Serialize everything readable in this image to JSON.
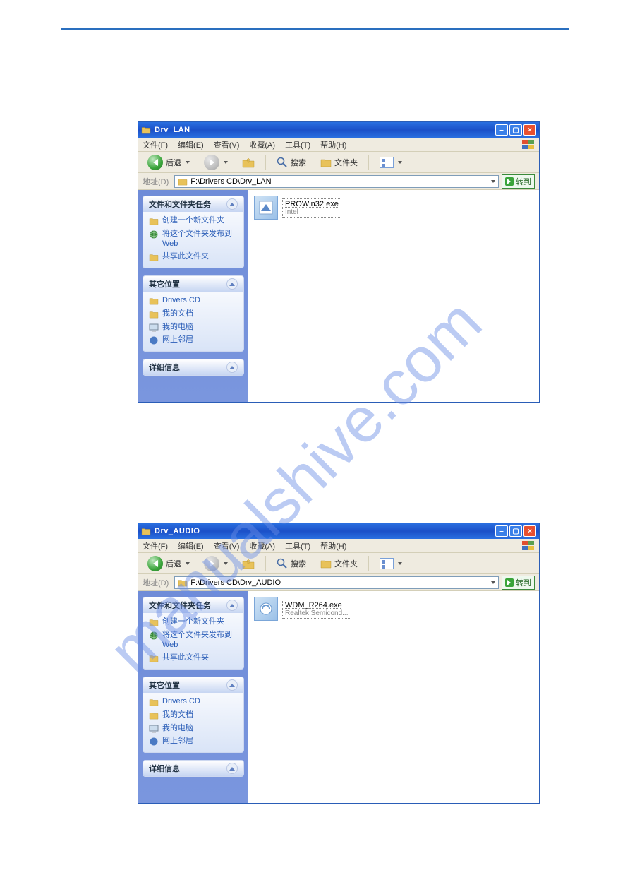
{
  "watermark": ".com",
  "window1": {
    "title": "Drv_LAN",
    "menus": {
      "file": "文件(F)",
      "edit": "编辑(E)",
      "view": "查看(V)",
      "fav": "收藏(A)",
      "tools": "工具(T)",
      "help": "帮助(H)"
    },
    "toolbar": {
      "back": "后退",
      "search": "搜索",
      "folders": "文件夹"
    },
    "address": {
      "label": "地址(D)",
      "path": "F:\\Drivers CD\\Drv_LAN",
      "go": "转到"
    },
    "sidebar": {
      "tasks_title": "文件和文件夹任务",
      "tasks": {
        "new": "创建一个新文件夹",
        "publish": "将这个文件夹发布到 Web",
        "share": "共享此文件夹"
      },
      "places_title": "其它位置",
      "places": {
        "drivers": "Drivers CD",
        "docs": "我的文档",
        "computer": "我的电脑",
        "network": "网上邻居"
      },
      "details_title": "详细信息"
    },
    "file": {
      "name": "PROWin32.exe",
      "desc": "Intel"
    }
  },
  "window2": {
    "title": "Drv_AUDIO",
    "menus": {
      "file": "文件(F)",
      "edit": "编辑(E)",
      "view": "查看(V)",
      "fav": "收藏(A)",
      "tools": "工具(T)",
      "help": "帮助(H)"
    },
    "toolbar": {
      "back": "后退",
      "search": "搜索",
      "folders": "文件夹"
    },
    "address": {
      "label": "地址(D)",
      "path": "F:\\Drivers CD\\Drv_AUDIO",
      "go": "转到"
    },
    "sidebar": {
      "tasks_title": "文件和文件夹任务",
      "tasks": {
        "new": "创建一个新文件夹",
        "publish": "将这个文件夹发布到 Web",
        "share": "共享此文件夹"
      },
      "places_title": "其它位置",
      "places": {
        "drivers": "Drivers CD",
        "docs": "我的文档",
        "computer": "我的电脑",
        "network": "网上邻居"
      },
      "details_title": "详细信息"
    },
    "file": {
      "name": "WDM_R264.exe",
      "desc": "Realtek Semicond..."
    }
  }
}
